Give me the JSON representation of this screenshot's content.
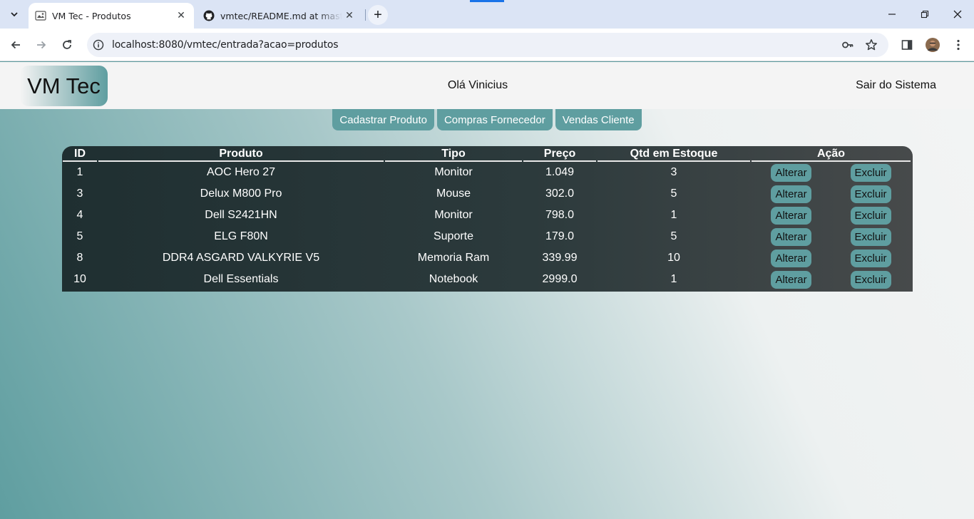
{
  "browser": {
    "tabs": [
      {
        "title": "VM Tec - Produtos",
        "active": true,
        "icon": "page-favicon"
      },
      {
        "title": "vmtec/README.md at master · ",
        "active": false,
        "icon": "github-icon"
      }
    ],
    "url": "localhost:8080/vmtec/entrada?acao=produtos"
  },
  "header": {
    "logo": "VM Tec",
    "greeting": "Olá Vinicius",
    "logout": "Sair do Sistema"
  },
  "menu": [
    {
      "label": "Cadastrar Produto"
    },
    {
      "label": "Compras Fornecedor"
    },
    {
      "label": "Vendas Cliente"
    }
  ],
  "table": {
    "headers": {
      "id": "ID",
      "product": "Produto",
      "type": "Tipo",
      "price": "Preço",
      "stock": "Qtd em Estoque",
      "action": "Ação"
    },
    "action_labels": {
      "edit": "Alterar",
      "delete": "Excluir"
    },
    "rows": [
      {
        "id": "1",
        "product": "AOC Hero 27",
        "type": "Monitor",
        "price": "1.049",
        "stock": "3"
      },
      {
        "id": "3",
        "product": "Delux M800 Pro",
        "type": "Mouse",
        "price": "302.0",
        "stock": "5"
      },
      {
        "id": "4",
        "product": "Dell S2421HN",
        "type": "Monitor",
        "price": "798.0",
        "stock": "1"
      },
      {
        "id": "5",
        "product": "ELG F80N",
        "type": "Suporte",
        "price": "179.0",
        "stock": "5"
      },
      {
        "id": "8",
        "product": "DDR4 ASGARD VALKYRIE V5",
        "type": "Memoria Ram",
        "price": "339.99",
        "stock": "10"
      },
      {
        "id": "10",
        "product": "Dell Essentials",
        "type": "Notebook",
        "price": "2999.0",
        "stock": "1"
      }
    ]
  },
  "colors": {
    "accent": "#5f9ea0",
    "table_dark": "#1f2f31",
    "header_bg": "#f4f4f4"
  }
}
